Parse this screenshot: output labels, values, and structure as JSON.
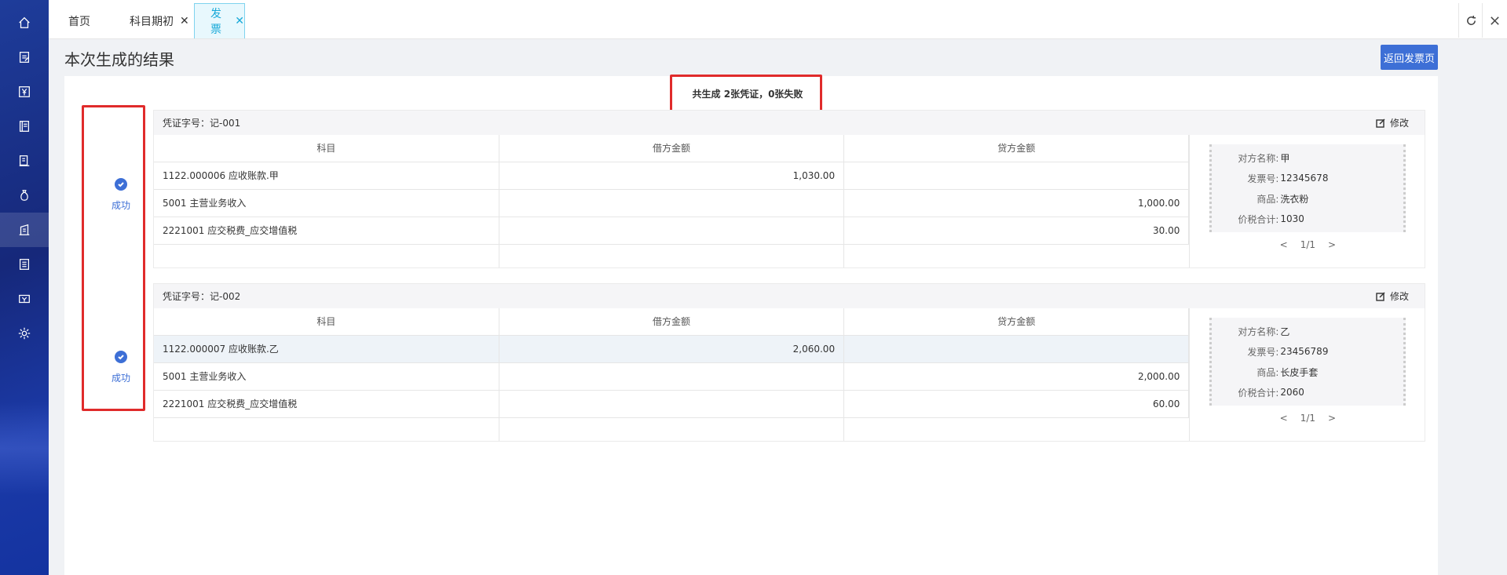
{
  "sidebar": {
    "items": [
      {
        "icon": "home-icon"
      },
      {
        "icon": "document-icon"
      },
      {
        "icon": "yen-icon"
      },
      {
        "icon": "ledger-icon"
      },
      {
        "icon": "report-icon"
      },
      {
        "icon": "money-bag-icon"
      },
      {
        "icon": "building-icon",
        "active": true
      },
      {
        "icon": "list-icon"
      },
      {
        "icon": "invoice-icon"
      },
      {
        "icon": "gear-icon"
      }
    ]
  },
  "tabs": [
    {
      "label": "首页",
      "closable": false
    },
    {
      "label": "科目期初",
      "closable": true
    },
    {
      "label": "发票",
      "closable": true,
      "active": true
    }
  ],
  "page": {
    "title": "本次生成的结果",
    "back_button": "返回发票页",
    "summary": "共生成 2张凭证，0张失败"
  },
  "columns": [
    "科目",
    "借方金额",
    "贷方金额"
  ],
  "edit_label": "修改",
  "vouchers": [
    {
      "status": "成功",
      "voucher_no": "凭证字号：记-001",
      "rows": [
        {
          "account": "1122.000006 应收账款.甲",
          "debit": "1,030.00",
          "credit": ""
        },
        {
          "account": "5001 主营业务收入",
          "debit": "",
          "credit": "1,000.00"
        },
        {
          "account": "2221001 应交税费_应交增值税",
          "debit": "",
          "credit": "30.00"
        }
      ],
      "invoice": [
        {
          "key": "对方名称:",
          "value": "甲"
        },
        {
          "key": "发票号:",
          "value": "12345678"
        },
        {
          "key": "商品:",
          "value": "洗衣粉"
        },
        {
          "key": "价税合计:",
          "value": "1030"
        }
      ],
      "pager": "1/1"
    },
    {
      "status": "成功",
      "voucher_no": "凭证字号：记-002",
      "rows": [
        {
          "account": "1122.000007 应收账款.乙",
          "debit": "2,060.00",
          "credit": "",
          "highlight": true
        },
        {
          "account": "5001 主营业务收入",
          "debit": "",
          "credit": "2,000.00"
        },
        {
          "account": "2221001 应交税费_应交增值税",
          "debit": "",
          "credit": "60.00"
        }
      ],
      "invoice": [
        {
          "key": "对方名称:",
          "value": "乙"
        },
        {
          "key": "发票号:",
          "value": "23456789"
        },
        {
          "key": "商品:",
          "value": "长皮手套"
        },
        {
          "key": "价税合计:",
          "value": "2060"
        }
      ],
      "pager": "1/1"
    }
  ],
  "colors": {
    "accent": "#3d6fd6",
    "tab_active": "#18a9d8",
    "highlight_box": "#e02b2b"
  }
}
